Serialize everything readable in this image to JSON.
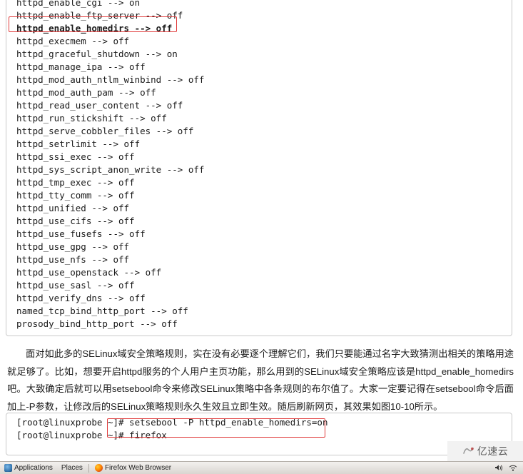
{
  "terminal_top": {
    "lines": [
      "httpd_enable_cgi --> on",
      "httpd_enable_ftp_server --> off",
      "httpd_enable_homedirs --> off",
      "httpd_execmem --> off",
      "httpd_graceful_shutdown --> on",
      "httpd_manage_ipa --> off",
      "httpd_mod_auth_ntlm_winbind --> off",
      "httpd_mod_auth_pam --> off",
      "httpd_read_user_content --> off",
      "httpd_run_stickshift --> off",
      "httpd_serve_cobbler_files --> off",
      "httpd_setrlimit --> off",
      "httpd_ssi_exec --> off",
      "httpd_sys_script_anon_write --> off",
      "httpd_tmp_exec --> off",
      "httpd_tty_comm --> off",
      "httpd_unified --> off",
      "httpd_use_cifs --> off",
      "httpd_use_fusefs --> off",
      "httpd_use_gpg --> off",
      "httpd_use_nfs --> off",
      "httpd_use_openstack --> off",
      "httpd_use_sasl --> off",
      "httpd_verify_dns --> off",
      "named_tcp_bind_http_port --> off",
      "prosody_bind_http_port --> off"
    ],
    "highlighted_line_index": 2
  },
  "paragraph": {
    "text": "面对如此多的SELinux域安全策略规则，实在没有必要逐个理解它们，我们只要能通过名字大致猜测出相关的策略用途就足够了。比如，想要开启httpd服务的个人用户主页功能，那么用到的SELinux域安全策略应该是httpd_enable_homedirs吧。大致确定后就可以用setsebool命令来修改SELinux策略中各条规则的布尔值了。大家一定要记得在setsebool命令后面加上-P参数，让修改后的SELinux策略规则永久生效且立即生效。随后刷新网页，其效果如图10-10所示。"
  },
  "terminal_bottom": {
    "lines": [
      "[root@linuxprobe ~]# setsebool -P httpd_enable_homedirs=on",
      "[root@linuxprobe ~]# firefox"
    ],
    "highlighted_command": "setsebool -P httpd_enable_homedirs=on"
  },
  "taskbar": {
    "applications_label": "Applications",
    "places_label": "Places",
    "window_label": "Firefox Web Browser",
    "volume_icon": "speaker-icon",
    "network_icon": "network-icon"
  },
  "watermark": {
    "text": "亿速云"
  },
  "colors": {
    "highlight_border": "#e03b3b",
    "code_border": "#c9c9c9",
    "text": "#1a1a1a"
  }
}
